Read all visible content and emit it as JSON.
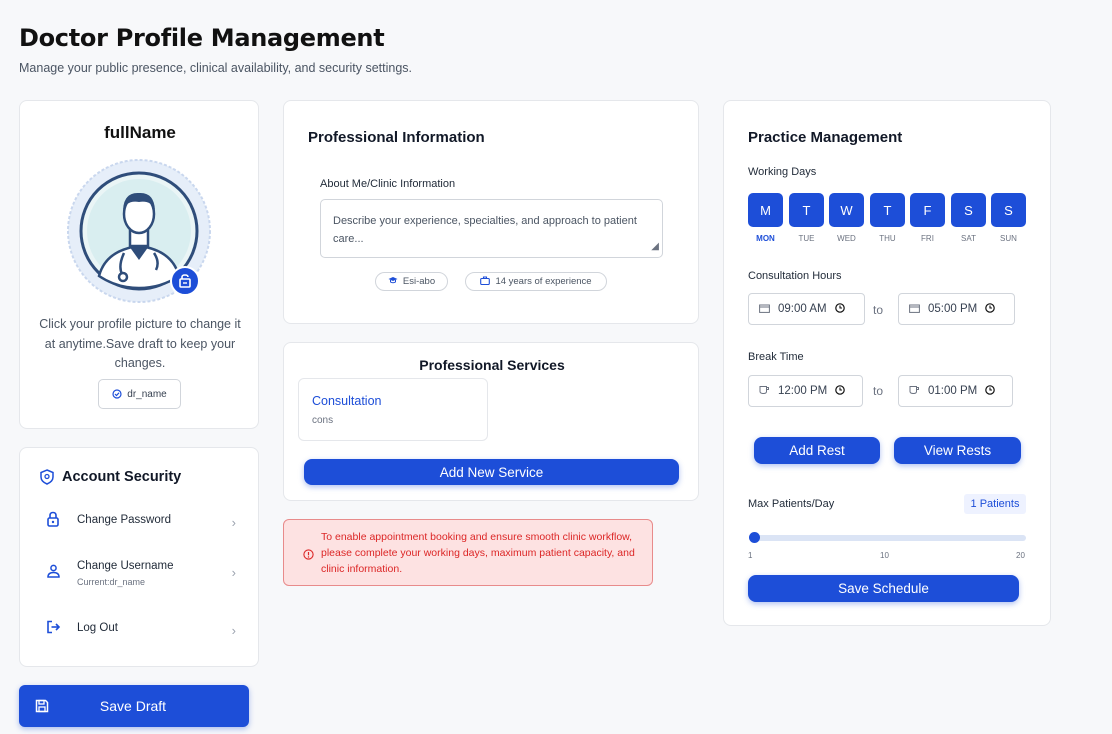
{
  "header": {
    "title": "Doctor Profile Management",
    "subtitle": "Manage your public presence, clinical availability, and security settings."
  },
  "profile": {
    "full_name": "fullName",
    "hint": "Click your profile picture to change it at anytime.Save draft to keep your changes.",
    "username_badge": "dr_name"
  },
  "security": {
    "title": "Account Security",
    "items": [
      {
        "label": "Change Password",
        "sub": ""
      },
      {
        "label": "Change Username",
        "sub": "Current:dr_name"
      },
      {
        "label": "Log Out",
        "sub": ""
      }
    ]
  },
  "save_draft_label": "Save Draft",
  "professional_info": {
    "title": "Professional Information",
    "about_label": "About Me/Clinic Information",
    "about_placeholder": "Describe your experience, specialties, and approach to patient care...",
    "pills": [
      "Esi-abo",
      "14 years of experience"
    ]
  },
  "services": {
    "title": "Professional Services",
    "items": [
      {
        "name": "Consultation",
        "desc": "cons"
      }
    ],
    "add_label": "Add New Service"
  },
  "alert": {
    "text": "To enable appointment booking and ensure smooth clinic workflow, please complete your working days, maximum patient capacity, and clinic information.",
    "color": "#dc2626"
  },
  "practice": {
    "title": "Practice Management",
    "working_days_label": "Working Days",
    "days": [
      {
        "letter": "M",
        "name": "MON",
        "active": true
      },
      {
        "letter": "T",
        "name": "TUE",
        "active": false
      },
      {
        "letter": "W",
        "name": "WED",
        "active": false
      },
      {
        "letter": "T",
        "name": "THU",
        "active": false
      },
      {
        "letter": "F",
        "name": "FRI",
        "active": false
      },
      {
        "letter": "S",
        "name": "SAT",
        "active": false
      },
      {
        "letter": "S",
        "name": "SUN",
        "active": false
      }
    ],
    "consult_label": "Consultation Hours",
    "consult_start": "09:00 AM",
    "consult_end": "05:00 PM",
    "break_label": "Break Time",
    "break_start": "12:00 PM",
    "break_end": "01:00 PM",
    "to_text": "to",
    "add_rest": "Add Rest",
    "view_rests": "View Rests",
    "max_label": "Max Patients/Day",
    "max_badge": "1 Patients",
    "slider": {
      "min": "1",
      "mid": "10",
      "max": "20",
      "value": 1
    },
    "save_schedule": "Save Schedule"
  },
  "colors": {
    "accent": "#1d4ed8",
    "alert_bg": "#fde2e2"
  }
}
